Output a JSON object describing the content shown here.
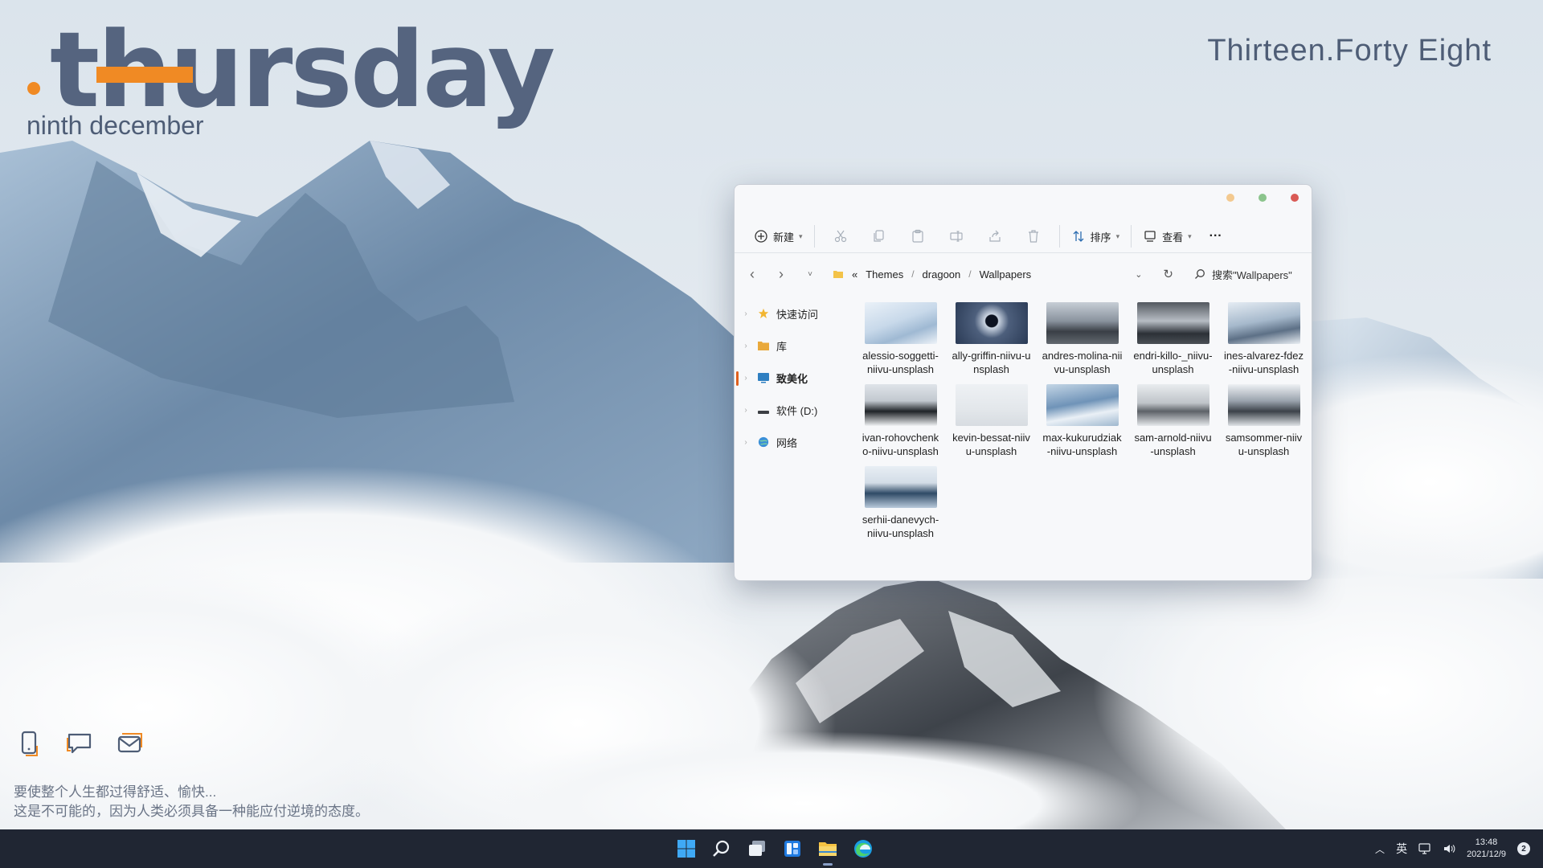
{
  "widget": {
    "day": "thursday",
    "date": "ninth december",
    "time": "Thirteen.Forty Eight",
    "accent_color": "#f08a24",
    "icons": [
      "phone-icon",
      "chat-icon",
      "mail-icon"
    ],
    "quote_line1": "要使整个人生都过得舒适、愉快...",
    "quote_line2": "这是不可能的，因为人类必须具备一种能应付逆境的态度。"
  },
  "explorer": {
    "window_dots": [
      "#f3c98f",
      "#8bc48c",
      "#d95a55"
    ],
    "toolbar": {
      "new_label": "新建",
      "sort_label": "排序",
      "view_label": "查看",
      "more_label": "···"
    },
    "address": {
      "prefix": "«",
      "crumbs": [
        "Themes",
        "dragoon",
        "Wallpapers"
      ],
      "search_placeholder": "搜索\"Wallpapers\""
    },
    "sidebar": [
      {
        "label": "快速访问",
        "icon": "star-icon"
      },
      {
        "label": "库",
        "icon": "folder-icon"
      },
      {
        "label": "致美化",
        "icon": "monitor-icon"
      },
      {
        "label": "软件 (D:)",
        "icon": "drive-icon"
      },
      {
        "label": "网络",
        "icon": "network-icon"
      }
    ],
    "files": [
      {
        "name": "alessio-soggetti-niivu-unsplash",
        "thumb": "linear-gradient(160deg,#eaf1f8 0%,#c8d9ea 45%,#9fb9d3 70%,#eef3f8 100%)"
      },
      {
        "name": "ally-griffin-niivu-unsplash",
        "thumb": "radial-gradient(circle at 50% 45%,#0c1220 0 14%,#cbd5e2 16%,#4d5f7c 40%,#2a3a55 100%)"
      },
      {
        "name": "andres-molina-niivu-unsplash",
        "thumb": "linear-gradient(180deg,#c7ced6 0%,#8a939e 45%,#3a3f46 70%,#62686f 100%)"
      },
      {
        "name": "endri-killo-_niivu-unsplash",
        "thumb": "linear-gradient(180deg,#53585f 0%,#b7bdc4 45%,#2c3137 75%,#4a4f55 100%)"
      },
      {
        "name": "ines-alvarez-fdez-niivu-unsplash",
        "thumb": "linear-gradient(170deg,#e5ecf3 0%,#a6b9cc 45%,#5d7086 70%,#e9eef3 100%)"
      },
      {
        "name": "ivan-rohovchenko-niivu-unsplash",
        "thumb": "linear-gradient(180deg,#dfe4e9 0%,#c2c8cf 40%,#1f2327 65%,#f1f3f5 100%)"
      },
      {
        "name": "kevin-bessat-niivu-unsplash",
        "thumb": "linear-gradient(180deg,#eef1f4 0%,#e3e7eb 60%,#d7dce1 100%)"
      },
      {
        "name": "max-kukurudziak-niivu-unsplash",
        "thumb": "linear-gradient(170deg,#c4d6e6 0%,#6f93b8 45%,#eaf0f6 70%,#9fb8cf 100%)"
      },
      {
        "name": "sam-arnold-niivu-unsplash",
        "thumb": "linear-gradient(180deg,#e9ecef 0%,#bfc4c9 45%,#5d6268 65%,#e7eaed 100%)"
      },
      {
        "name": "samsommer-niivu-unsplash",
        "thumb": "linear-gradient(180deg,#eef1f4 0%,#9aa3ad 40%,#3c4249 65%,#dfe3e7 100%)"
      },
      {
        "name": "serhii-danevych-niivu-unsplash",
        "thumb": "linear-gradient(180deg,#e8eef4 0%,#d3dde7 40%,#2f4a66 65%,#b9cadb 100%)"
      }
    ]
  },
  "taskbar": {
    "apps": [
      "windows-start-icon",
      "search-icon",
      "task-view-icon",
      "widgets-icon",
      "file-explorer-icon",
      "edge-browser-icon"
    ],
    "tray_language": "英",
    "clock_time": "13:48",
    "clock_date": "2021/12/9",
    "notification_count": "2"
  }
}
